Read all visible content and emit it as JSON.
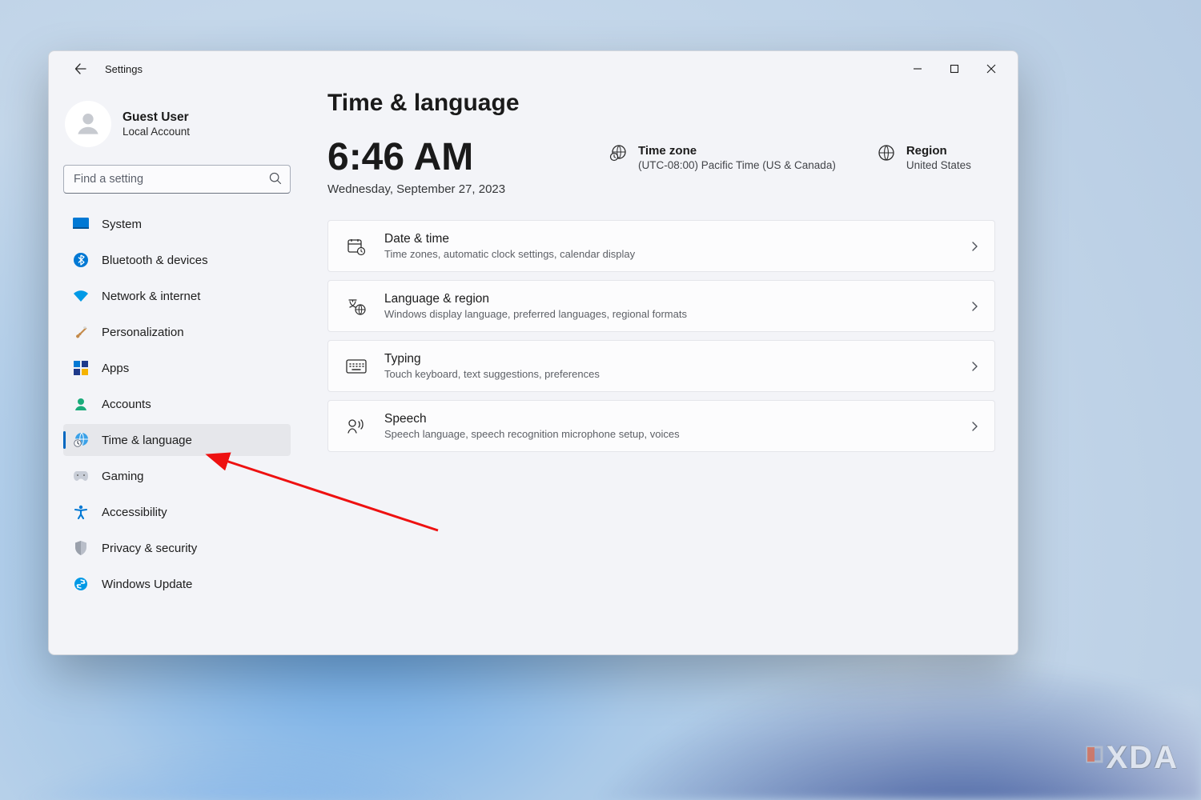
{
  "window": {
    "title": "Settings"
  },
  "user": {
    "name": "Guest User",
    "subtitle": "Local Account"
  },
  "search": {
    "placeholder": "Find a setting"
  },
  "nav": [
    {
      "label": "System"
    },
    {
      "label": "Bluetooth & devices"
    },
    {
      "label": "Network & internet"
    },
    {
      "label": "Personalization"
    },
    {
      "label": "Apps"
    },
    {
      "label": "Accounts"
    },
    {
      "label": "Time & language"
    },
    {
      "label": "Gaming"
    },
    {
      "label": "Accessibility"
    },
    {
      "label": "Privacy & security"
    },
    {
      "label": "Windows Update"
    }
  ],
  "page": {
    "title": "Time & language"
  },
  "clock": {
    "time": "6:46 AM",
    "date": "Wednesday, September 27, 2023"
  },
  "timezone": {
    "label": "Time zone",
    "value": "(UTC-08:00) Pacific Time (US & Canada)"
  },
  "region": {
    "label": "Region",
    "value": "United States"
  },
  "cards": [
    {
      "title": "Date & time",
      "sub": "Time zones, automatic clock settings, calendar display"
    },
    {
      "title": "Language & region",
      "sub": "Windows display language, preferred languages, regional formats"
    },
    {
      "title": "Typing",
      "sub": "Touch keyboard, text suggestions, preferences"
    },
    {
      "title": "Speech",
      "sub": "Speech language, speech recognition microphone setup, voices"
    }
  ],
  "watermark": "XDA"
}
